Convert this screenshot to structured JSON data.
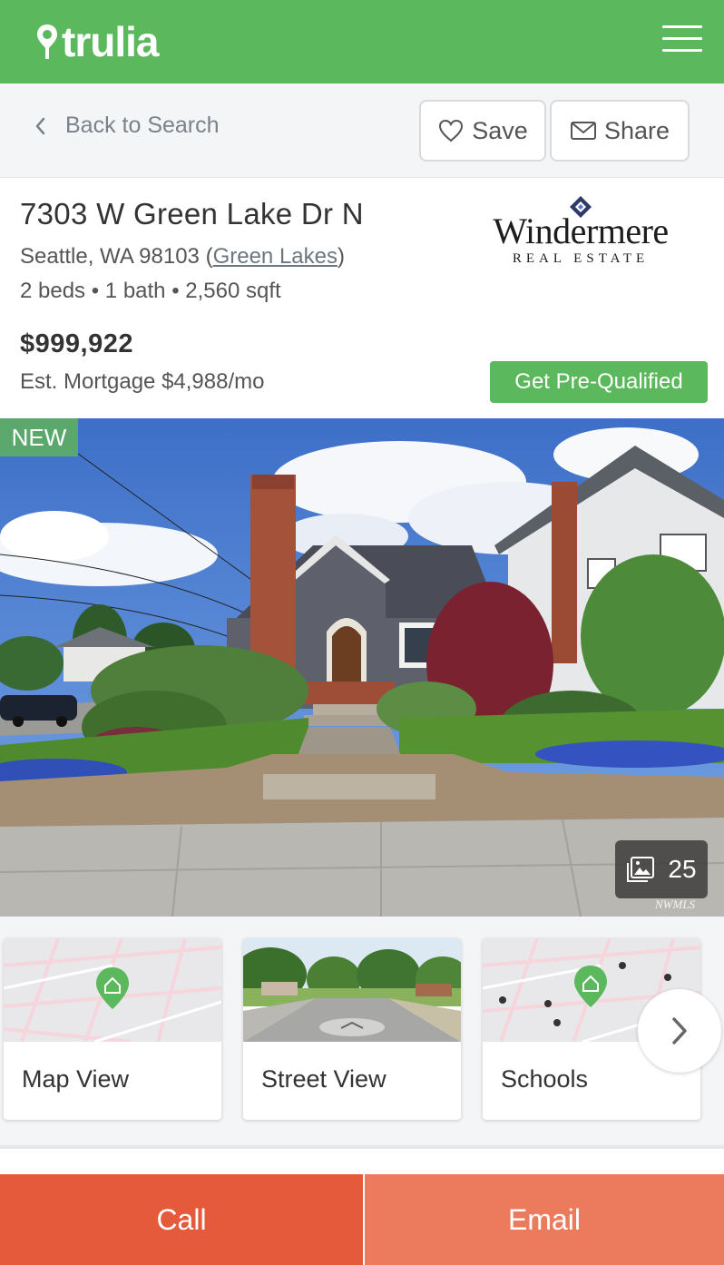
{
  "header": {
    "logo_text": "trulia",
    "menu_icon": "hamburger-menu-icon",
    "brand_color": "#5cb85c"
  },
  "subnav": {
    "back_label": "Back to Search",
    "save_label": "Save",
    "share_label": "Share"
  },
  "listing": {
    "address": "7303 W Green Lake Dr N",
    "city_state_zip": "Seattle, WA 98103",
    "neighborhood": "Green Lakes",
    "facts": "2 beds • 1 bath • 2,560 sqft",
    "price": "$999,922",
    "mortgage": "Est. Mortgage $4,988/mo",
    "prequal_label": "Get Pre-Qualified",
    "brokerage_name": "Windermere",
    "brokerage_sub": "REAL ESTATE"
  },
  "photo": {
    "badge": "NEW",
    "count": "25",
    "watermark": "NWMLS"
  },
  "cards": [
    {
      "label": "Map View"
    },
    {
      "label": "Street View"
    },
    {
      "label": "Schools"
    }
  ],
  "actions": {
    "call_label": "Call",
    "email_label": "Email",
    "call_color": "#e55a3a",
    "email_color": "#ec7b5d"
  }
}
